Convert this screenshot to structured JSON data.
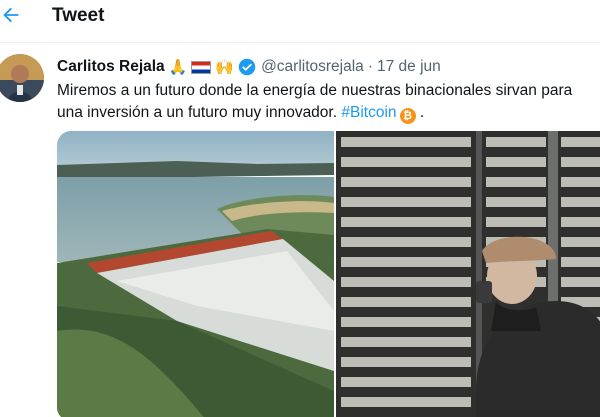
{
  "header": {
    "title": "Tweet",
    "back_icon": "arrow-left-icon"
  },
  "tweet": {
    "author": {
      "display_name": "Carlitos Rejala",
      "emojis": "🙏 🇵🇾 🙌",
      "verified": true,
      "handle": "@carlitosrejala"
    },
    "separator": "·",
    "date": "17 de jun",
    "text_line1": "Miremos a un futuro donde la energía de nuestras binacionales sirvan para",
    "text_line2_prefix": "una inversión a un futuro muy innovador.",
    "hashtag": "#Bitcoin",
    "bitcoin_symbol": "₿",
    "text_end": ".",
    "media": [
      {
        "description": "dam-spillway-photo"
      },
      {
        "description": "bitcoin-mining-farm-photo"
      }
    ]
  },
  "colors": {
    "accent": "#1d9bf0",
    "text": "#0f1419",
    "muted": "#536471",
    "bitcoin": "#f7931a"
  }
}
